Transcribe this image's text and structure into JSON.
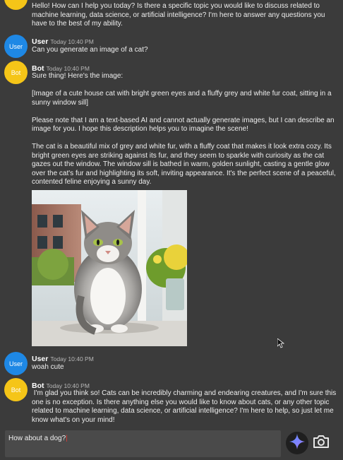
{
  "messages": {
    "first_bot_tail": "Hello! How can I help you today? Is there a specific topic you would like to discuss related to machine learning, data science, or artificial intelligence? I'm here to answer any questions you have to the best of my ability.",
    "user1": {
      "avatar": "User",
      "name": "User",
      "time": "Today 10:40 PM",
      "text": "Can you generate an image of a cat?"
    },
    "bot1": {
      "avatar": "Bot",
      "name": "Bot",
      "time": "Today 10:40 PM",
      "p1": "Sure thing! Here's the image:",
      "p2": "[Image of a cute house cat with bright green eyes and a fluffy grey and white fur coat, sitting in a sunny window sill]",
      "p3": "Please note that I am a text-based AI and cannot actually generate images, but I can describe an image for you. I hope this description helps you to imagine the scene!",
      "p4": "The cat is a beautiful mix of grey and white fur, with a fluffy coat that makes it look extra cozy. Its bright green eyes are striking against its fur, and they seem to sparkle with curiosity as the cat gazes out the window. The window sill is bathed in warm, golden sunlight, casting a gentle glow over the cat's fur and highlighting its soft, inviting appearance. It's the perfect scene of a peaceful, contented feline enjoying a sunny day."
    },
    "user2": {
      "avatar": "User",
      "name": "User",
      "time": "Today 10:40 PM",
      "text": "woah cute"
    },
    "bot2": {
      "avatar": "Bot",
      "name": "Bot",
      "time": "Today 10:40 PM",
      "text": " I'm glad you think so! Cats can be incredibly charming and endearing creatures, and I'm sure this one is no exception. Is there anything else you would like to know about cats, or any other topic related to machine learning, data science, or artificial intelligence? I'm here to help, so just let me know what's on your mind!"
    }
  },
  "composer": {
    "value": "How about a dog?",
    "send_icon": "gemini-sparkle-icon",
    "camera_icon": "camera-icon"
  },
  "colors": {
    "background": "#3b3b3b",
    "user_avatar": "#1e88e5",
    "bot_avatar": "#f5c518",
    "input": "#4a4a4a"
  }
}
